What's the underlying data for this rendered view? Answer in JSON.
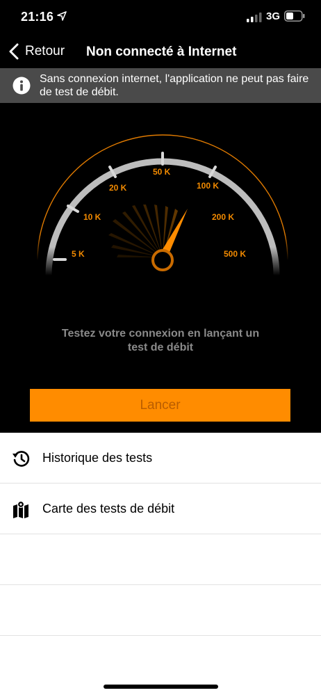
{
  "status_bar": {
    "time": "21:16",
    "network": "3G",
    "location_icon": "location-arrow-icon",
    "signal_icon": "cellular-signal-icon",
    "battery_icon": "battery-icon"
  },
  "nav": {
    "back_label": "Retour",
    "title": "Non connecté à Internet"
  },
  "banner": {
    "message": "Sans connexion internet, l'application ne peut pas faire de test de débit.",
    "icon": "info-icon",
    "background": "#4a4a4a"
  },
  "gauge": {
    "labels": [
      "5 K",
      "10 K",
      "20 K",
      "50 K",
      "100 K",
      "200 K",
      "500 K"
    ],
    "accent": "#f28a00"
  },
  "prompt": "Testez votre connexion en lançant un test de débit",
  "launch_button": {
    "label": "Lancer",
    "background": "#ff8c00"
  },
  "menu": [
    {
      "label": "Historique des tests",
      "icon": "history-icon"
    },
    {
      "label": "Carte des tests de débit",
      "icon": "map-icon"
    }
  ]
}
